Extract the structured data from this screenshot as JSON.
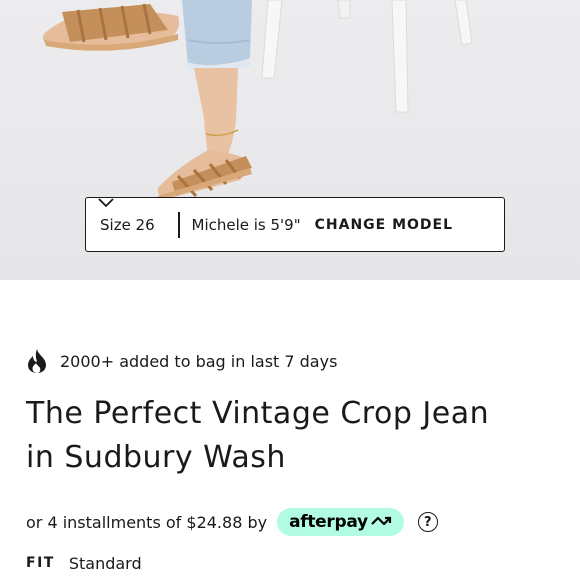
{
  "hero": {
    "model_bar": {
      "size_text": "Size 26",
      "model_text": "Michele is 5'9\"",
      "change_model_label": "CHANGE MODEL"
    }
  },
  "product": {
    "popularity_text": "2000+ added to bag in last 7 days",
    "title_line1": "The Perfect Vintage Crop Jean",
    "title_line2": "in Sudbury Wash",
    "installments_text": "or 4 installments of $24.88 by",
    "afterpay_label": "afterpay",
    "info_symbol": "?",
    "fit_label": "FIT",
    "fit_value": "Standard"
  },
  "icons": {
    "popularity": "flame-icon",
    "change_model": "chevron-down-icon",
    "afterpay": "afterpay-arrows-icon",
    "info": "question-circle-icon"
  },
  "colors": {
    "afterpay_badge": "#b2fce4",
    "hero_background": "#ecebed",
    "text": "#1a1a1a"
  }
}
